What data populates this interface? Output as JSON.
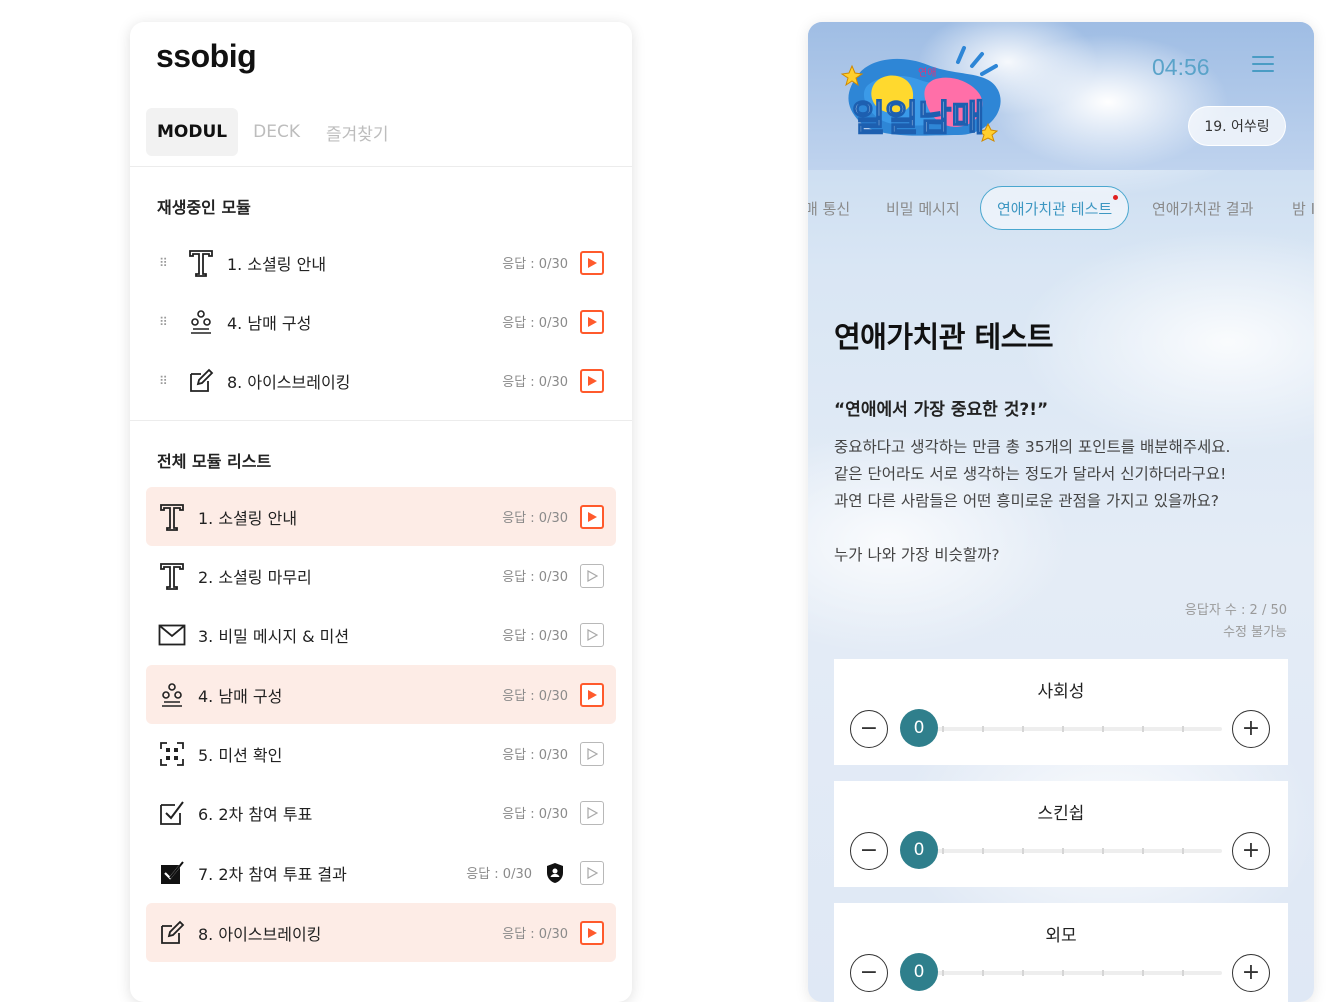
{
  "left": {
    "brand": "ssobig",
    "tabs": [
      "MODUL",
      "DECK",
      "즐겨찾기"
    ],
    "section_playing": "재생중인 모듈",
    "playing": [
      {
        "icon": "text-icon",
        "title": "1. 소셜링 안내",
        "resp": "응답 : 0/30"
      },
      {
        "icon": "group-icon",
        "title": "4. 남매 구성",
        "resp": "응답 : 0/30"
      },
      {
        "icon": "edit-icon",
        "title": "8. 아이스브레이킹",
        "resp": "응답 : 0/30"
      }
    ],
    "section_all": "전체 모듈 리스트",
    "all": [
      {
        "icon": "text-icon",
        "title": "1. 소셜링 안내",
        "resp": "응답 : 0/30",
        "active": true
      },
      {
        "icon": "text-icon",
        "title": "2. 소셜링 마무리",
        "resp": "응답 : 0/30",
        "active": false
      },
      {
        "icon": "mail-icon",
        "title": "3. 비밀 메시지 & 미션",
        "resp": "응답 : 0/30",
        "active": false
      },
      {
        "icon": "group-icon",
        "title": "4. 남매 구성",
        "resp": "응답 : 0/30",
        "active": true
      },
      {
        "icon": "qr-icon",
        "title": "5. 미션 확인",
        "resp": "응답 : 0/30",
        "active": false
      },
      {
        "icon": "checkbox-icon",
        "title": "6. 2차 참여 투표",
        "resp": "응답 : 0/30",
        "active": false
      },
      {
        "icon": "checkbox-filled-icon",
        "title": "7. 2차 참여 투표 결과",
        "resp": "응답 : 0/30",
        "active": false,
        "shield": true
      },
      {
        "icon": "edit-icon",
        "title": "8. 아이스브레이킹",
        "resp": "응답 : 0/30",
        "active": true
      }
    ]
  },
  "right": {
    "logo_small": "연애",
    "logo_text": "일일남매",
    "timer": "04:56",
    "user_chip": "19. 어쑤링",
    "tabs": [
      "매 통신",
      "비밀 메시지",
      "연애가치관 테스트",
      "연애가치관 결과",
      "밤 I"
    ],
    "title": "연애가치관 테스트",
    "quote": "“연애에서 가장 중요한 것?!”",
    "desc": [
      "중요하다고 생각하는 만큼 총 35개의 포인트를 배분해주세요.",
      "같은 단어라도 서로 생각하는 정도가 달라서 신기하더라구요!",
      "과연 다른 사람들은 어떤 흥미로운 관점을 가지고 있을까요?"
    ],
    "question": "누가 나와 가장 비슷할까?",
    "respondents": "응답자 수 : 2 / 50",
    "edit_status": "수정 불가능",
    "sliders": [
      {
        "label": "사회성",
        "value": "0"
      },
      {
        "label": "스킨쉽",
        "value": "0"
      },
      {
        "label": "외모",
        "value": "0"
      }
    ],
    "minus": "−",
    "plus": "+"
  },
  "colors": {
    "accent_orange": "#ff5a2c",
    "highlight_row": "#fdece6",
    "teal_knob": "#2f7f8c",
    "timer_blue": "#5aa3c9"
  }
}
